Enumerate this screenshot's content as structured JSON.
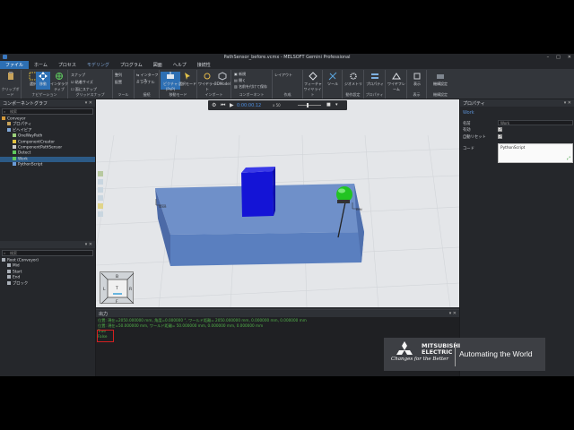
{
  "window": {
    "title": "PathSensor_before.vcmx - MELSOFT Gemini Professional"
  },
  "menu": [
    "ファイル",
    "ホーム",
    "プロセス",
    "モデリング",
    "プログラム",
    "図面",
    "ヘルプ",
    "接続性"
  ],
  "menu_active_index": 0,
  "ribbon": {
    "groups": [
      "クリップボード",
      "ナビゲーション",
      "グリッドスナップ",
      "ツール",
      "接続",
      "移動モード",
      "インポート",
      "コンポーネント",
      "作成",
      "ワイヤライト",
      "動作設定",
      "プロパティ",
      "表示",
      "機構設定"
    ],
    "buttons": {
      "select": "選択",
      "move": "移動",
      "interactive": "インタラクティブ",
      "snap_label": "スナップ",
      "grid_size": "粘着サイズ",
      "auto_snap": "面にスナップ",
      "align": "整列",
      "place": "配置",
      "interface": "インターフェース",
      "signal": "シグナル",
      "pnp": "ピクチャ (PnP)",
      "select_mode": "選択モード",
      "geometry": "ワイヤライト",
      "import_3d": "3DModel",
      "new": "新規",
      "open": "開く",
      "save_as_component": "名前を付けて保存",
      "feature": "フィーチャ",
      "tool": "ツール",
      "geo_tool": "ジオメトリ",
      "wireframe": "ワイヤフレーム",
      "property": "プロパティ",
      "show": "表示",
      "mechanism": "機構設定",
      "right_side": "レイアウト"
    }
  },
  "left_panel": {
    "title": "コンポーネントグラフ",
    "search_placeholder": "検索",
    "tree": [
      {
        "label": "Conveyor",
        "depth": 0
      },
      {
        "label": "プロパティ",
        "depth": 1
      },
      {
        "label": "ビヘイビア",
        "depth": 1
      },
      {
        "label": "OneWayPath",
        "depth": 2
      },
      {
        "label": "ComponentCreator",
        "depth": 2
      },
      {
        "label": "ComponentPathSensor",
        "depth": 2
      },
      {
        "label": "Detect",
        "depth": 2
      },
      {
        "label": "Work",
        "depth": 2,
        "selected": true
      },
      {
        "label": "PythonScript",
        "depth": 2
      }
    ],
    "lower_title": "",
    "lower_search_placeholder": "検索",
    "lower_tree": [
      {
        "label": "Root (Conveyor)",
        "depth": 0
      },
      {
        "label": "Mid",
        "depth": 1
      },
      {
        "label": "Start",
        "depth": 1
      },
      {
        "label": "End",
        "depth": 1
      },
      {
        "label": "ブロック",
        "depth": 1
      }
    ]
  },
  "viewport": {
    "playback_time": "0:00:00.12",
    "speed": "x 50"
  },
  "output": {
    "title": "出力",
    "lines": [
      {
        "text": "位置: 現在=2050.000000 mm, 角度=0.000000 °, ワールド距離= 2050.000000 mm, 0.000000 mm, 0.000000 mm",
        "style": "green"
      },
      {
        "text": "位置: 現在=50.000000 mm, ワールド距離= 50.000000 mm, 0.000000 mm, 0.000000 mm",
        "style": "green"
      },
      {
        "text": "True",
        "style": "green"
      },
      {
        "text": "False",
        "style": "green"
      }
    ]
  },
  "right_panel": {
    "title": "プロパティ",
    "header_value": "Work",
    "rows": [
      {
        "label": "名前",
        "value": "Work"
      },
      {
        "label": "有効",
        "checked": true
      },
      {
        "label": "自動リセット",
        "checked": true
      },
      {
        "label": "コード",
        "value": "PythonScript"
      }
    ]
  },
  "brand": {
    "name_line1": "MITSUBISHI",
    "name_line2": "ELECTRIC",
    "tagline": "Changes for the Better",
    "slogan": "Automating the World"
  },
  "colors": {
    "accent": "#2d6fb3",
    "output_text": "#53b34a",
    "highlight_box": "#d42020",
    "conveyor": "#5a7fbf",
    "box": "#1616d4",
    "sensor_light": "#22c422"
  }
}
